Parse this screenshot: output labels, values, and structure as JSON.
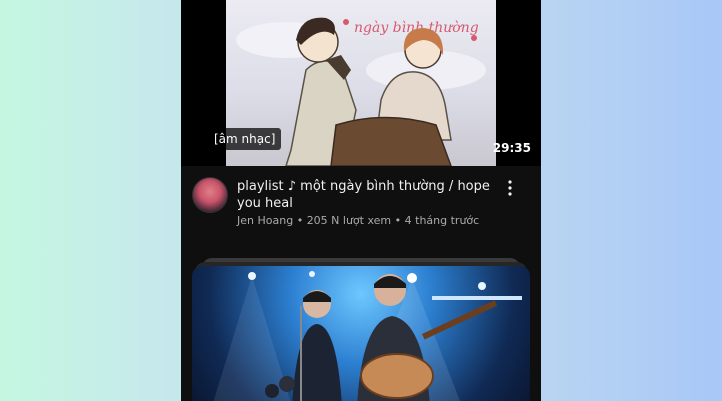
{
  "video1": {
    "chip": "[âm nhạc]",
    "duration": "29:35",
    "title": "playlist ♪ một ngày bình thường / hope you heal",
    "channel": "Jen Hoang",
    "views": "205 N lượt xem",
    "age": "4 tháng trước",
    "art_text": "ngày bình thường"
  },
  "icons": {
    "more": "more-vert-icon"
  }
}
